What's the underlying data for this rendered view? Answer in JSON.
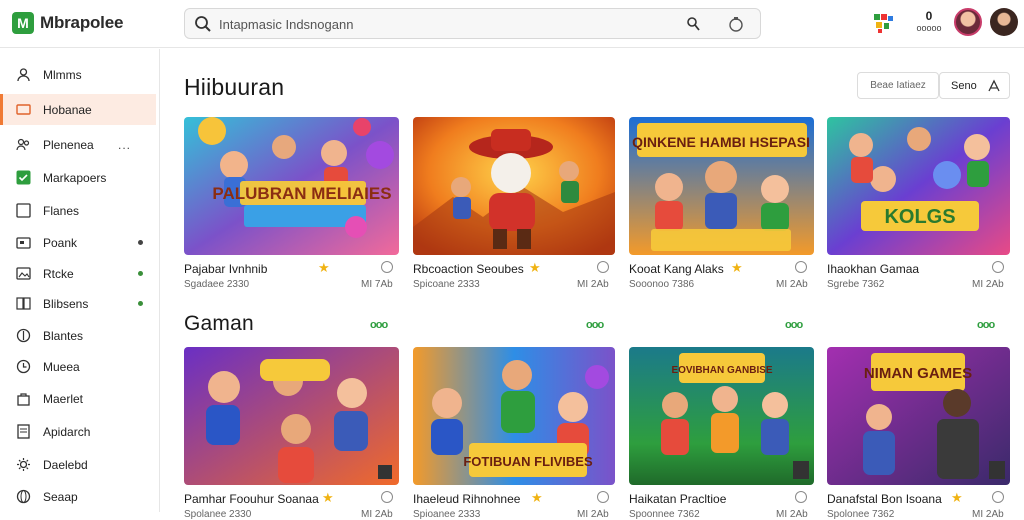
{
  "app": {
    "logo_text": "Mbrapolee"
  },
  "search": {
    "placeholder": "Intapmasic Indsnogann"
  },
  "notifications": {
    "count": "0",
    "dots": "ooooo"
  },
  "sidebar": {
    "items": [
      {
        "label": "Mlmms",
        "icon": "user-icon"
      },
      {
        "label": "Hobanae",
        "icon": "video-icon"
      },
      {
        "label": "Plenenea",
        "icon": "people-icon"
      },
      {
        "label": "Markapoers",
        "icon": "check-icon"
      },
      {
        "label": "Flanes",
        "icon": "square-icon"
      },
      {
        "label": "Poank",
        "icon": "folder-icon"
      },
      {
        "label": "Rtcke",
        "icon": "image-icon"
      },
      {
        "label": "Blibsens",
        "icon": "book-icon"
      },
      {
        "label": "Blantes",
        "icon": "leaf-icon"
      },
      {
        "label": "Mueea",
        "icon": "clock-icon"
      },
      {
        "label": "Maerlet",
        "icon": "bag-icon"
      },
      {
        "label": "Apidarch",
        "icon": "doc-icon"
      },
      {
        "label": "Daelebd",
        "icon": "gear-icon"
      },
      {
        "label": "Seaap",
        "icon": "globe-icon"
      }
    ],
    "ellipsis": "...",
    "accent": "#f07a34",
    "dot_color": "#3a8f3a"
  },
  "section1": {
    "title": "Hiibuuran",
    "sort_a": "Beae Iatiaez",
    "sort_b": "Seno",
    "cards": [
      {
        "title": "Pajabar Ivnhnib",
        "sub": "Sgadaee 2330",
        "meta": "MI 7Ab",
        "banner": "PALUBRAN MELIAIES"
      },
      {
        "title": "Rbcoaction Seoubes",
        "sub": "Spicoane 2333",
        "meta": "MI 2Ab",
        "banner": ""
      },
      {
        "title": "Kooat Kang Alaks",
        "sub": "Sooonoo 7386",
        "meta": "MI 2Ab",
        "banner": "QINKENE HAMBI HSEPASI"
      },
      {
        "title": "Ihaokhan Gamaa",
        "sub": "Sgrebe 7362",
        "meta": "MI 2Ab",
        "banner": "KOLGS"
      }
    ]
  },
  "section2": {
    "title": "Gaman",
    "more": "ooo",
    "cards": [
      {
        "title": "Pamhar Foouhur Soanaa",
        "sub": "Spolanee 2330",
        "meta": "MI 2Ab",
        "banner": ""
      },
      {
        "title": "Ihaeleud Rihnohnee",
        "sub": "Spioanee 2333",
        "meta": "MI 2Ab",
        "banner": "FOTIBUAN FLIVIBES"
      },
      {
        "title": "Haikatan Pracltioe",
        "sub": "Spoonnee 7362",
        "meta": "MI 2Ab",
        "banner": "EOVIBHAN GANBISE"
      },
      {
        "title": "Danafstal Bon Isoana",
        "sub": "Spolonee 7362",
        "meta": "MI 2Ab",
        "banner": "NIMAN GAMES"
      }
    ]
  },
  "colors": {
    "green": "#2e9e3e",
    "star": "#f0b313",
    "active_bg": "#fdebe2"
  }
}
